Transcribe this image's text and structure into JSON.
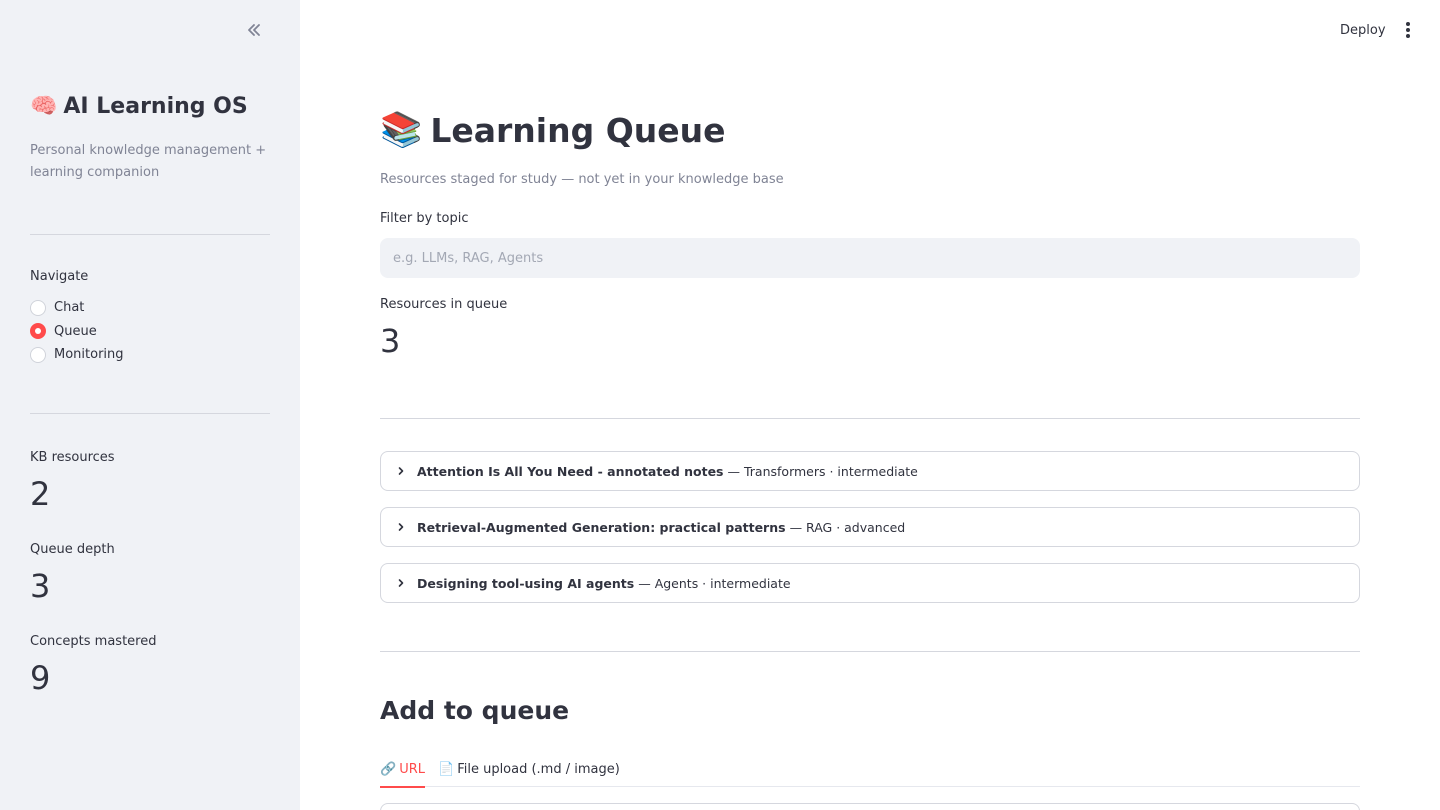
{
  "sidebar": {
    "title": "AI Learning OS",
    "title_emoji": "🧠",
    "caption": "Personal knowledge management + learning companion",
    "navigate_label": "Navigate",
    "nav_options": [
      {
        "label": "Chat",
        "checked": false
      },
      {
        "label": "Queue",
        "checked": true
      },
      {
        "label": "Monitoring",
        "checked": false
      }
    ],
    "metrics": [
      {
        "label": "KB resources",
        "value": "2"
      },
      {
        "label": "Queue depth",
        "value": "3"
      },
      {
        "label": "Concepts mastered",
        "value": "9"
      }
    ]
  },
  "header": {
    "deploy_label": "Deploy"
  },
  "main": {
    "title": "Learning Queue",
    "title_emoji": "📚",
    "caption": "Resources staged for study — not yet in your knowledge base",
    "filter": {
      "label": "Filter by topic",
      "placeholder": "e.g. LLMs, RAG, Agents",
      "value": ""
    },
    "metric": {
      "label": "Resources in queue",
      "value": "3"
    },
    "resources": [
      {
        "title": "Attention Is All You Need - annotated notes",
        "meta": "— Transformers · intermediate"
      },
      {
        "title": "Retrieval-Augmented Generation: practical patterns",
        "meta": "— RAG · advanced"
      },
      {
        "title": "Designing tool-using AI agents",
        "meta": "— Agents · intermediate"
      }
    ],
    "add_title": "Add to queue",
    "tabs": [
      {
        "icon": "🔗",
        "label": "URL",
        "active": true
      },
      {
        "icon": "📄",
        "label": "File upload (.md / image)",
        "active": false
      }
    ]
  },
  "colors": {
    "accent": "#ff4b4b",
    "sidebar_bg": "#f0f2f6",
    "text": "#31333f",
    "muted": "#808495",
    "border": "#d5d7de"
  }
}
